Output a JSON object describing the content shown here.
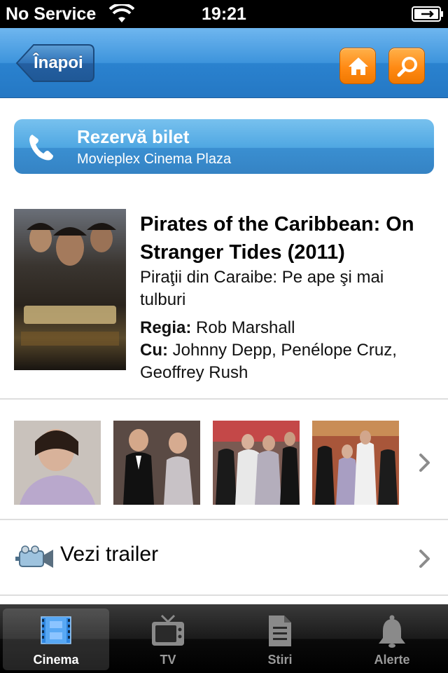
{
  "status_bar": {
    "carrier": "No Service",
    "time": "19:21"
  },
  "nav": {
    "back_label": "Înapoi"
  },
  "reserve": {
    "title": "Rezervă bilet",
    "subtitle": "Movieplex Cinema Plaza"
  },
  "movie": {
    "title": "Pirates of the Caribbean: On Stranger Tides (2011)",
    "title_ro": "Piraţii din Caraibe: Pe ape şi mai tulburi",
    "director_label": "Regia:",
    "director": "Rob Marshall",
    "cast_label": "Cu:",
    "cast": "Johnny Depp, Penélope Cruz, Geoffrey Rush"
  },
  "trailer": {
    "label": "Vezi trailer"
  },
  "tabs": [
    {
      "label": "Cinema",
      "icon": "film-icon",
      "active": true
    },
    {
      "label": "TV",
      "icon": "tv-icon",
      "active": false
    },
    {
      "label": "Stiri",
      "icon": "document-icon",
      "active": false
    },
    {
      "label": "Alerte",
      "icon": "bell-icon",
      "active": false
    }
  ],
  "colors": {
    "nav_blue": "#3d94dc",
    "accent_orange": "#ff8a14",
    "reserve_blue": "#4fa7e2"
  }
}
